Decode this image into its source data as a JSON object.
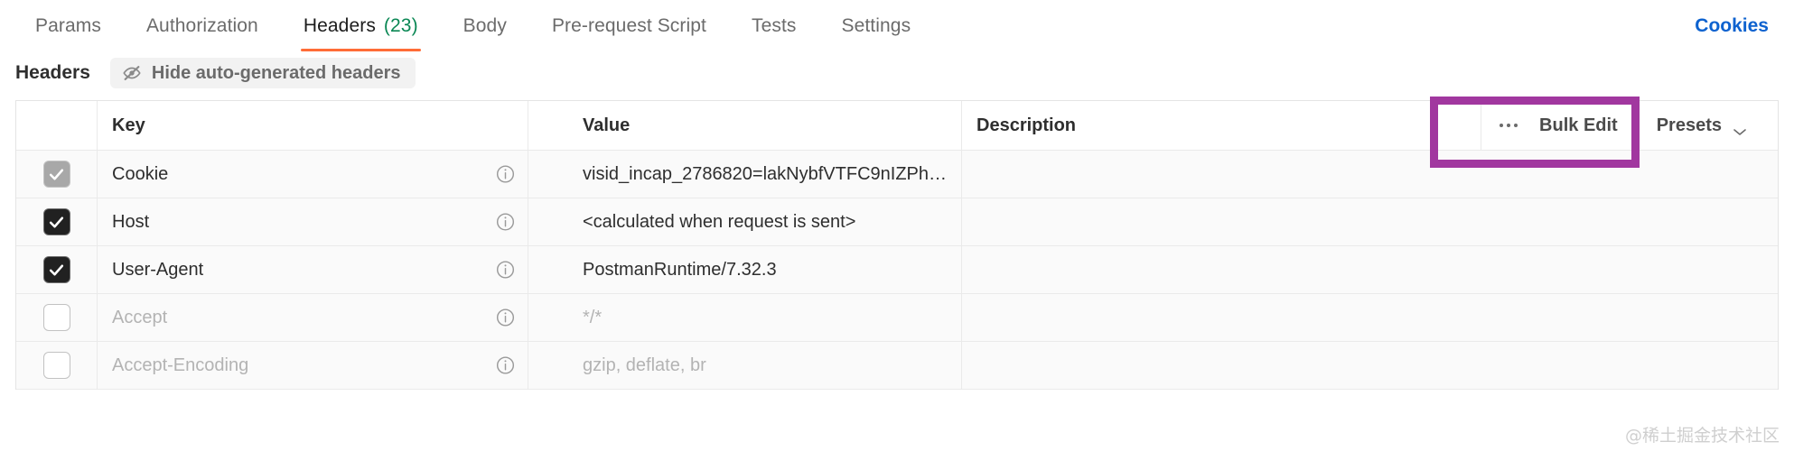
{
  "tabbar": {
    "tabs": [
      {
        "label": "Params",
        "active": false,
        "count": ""
      },
      {
        "label": "Authorization",
        "active": false,
        "count": ""
      },
      {
        "label": "Headers",
        "active": true,
        "count": "(23)"
      },
      {
        "label": "Body",
        "active": false,
        "count": ""
      },
      {
        "label": "Pre-request Script",
        "active": false,
        "count": ""
      },
      {
        "label": "Tests",
        "active": false,
        "count": ""
      },
      {
        "label": "Settings",
        "active": false,
        "count": ""
      }
    ],
    "cookies_label": "Cookies",
    "active_underline_color": "#ff6c37",
    "count_color": "#0a8754",
    "cookies_color": "#0d62cf"
  },
  "subbar": {
    "title": "Headers",
    "hide_button_label": "Hide auto-generated headers",
    "hide_button_icon": "eye-slash-icon"
  },
  "table": {
    "columns": {
      "key": "Key",
      "value": "Value",
      "description": "Description"
    },
    "actions": {
      "bulk_edit_label": "Bulk Edit",
      "bulk_edit_icon": "dots-horizontal-icon",
      "presets_label": "Presets",
      "presets_icon": "chevron-down-icon"
    },
    "rows": [
      {
        "checkbox": "checked-disabled",
        "key": "Cookie",
        "value": "visid_incap_2786820=lakNybfVTFC9nIZPhedzd9...",
        "description": "",
        "muted": false
      },
      {
        "checkbox": "checked",
        "key": "Host",
        "value": "<calculated when request is sent>",
        "description": "",
        "muted": false
      },
      {
        "checkbox": "checked",
        "key": "User-Agent",
        "value": "PostmanRuntime/7.32.3",
        "description": "",
        "muted": false
      },
      {
        "checkbox": "unchecked",
        "key": "Accept",
        "value": "*/*",
        "description": "",
        "muted": true
      },
      {
        "checkbox": "unchecked",
        "key": "Accept-Encoding",
        "value": "gzip, deflate, br",
        "description": "",
        "muted": true
      }
    ]
  },
  "annotation": {
    "color": "#a1379f",
    "target": "bulk-edit-button"
  },
  "watermark": {
    "text": "@稀土掘金技术社区"
  }
}
